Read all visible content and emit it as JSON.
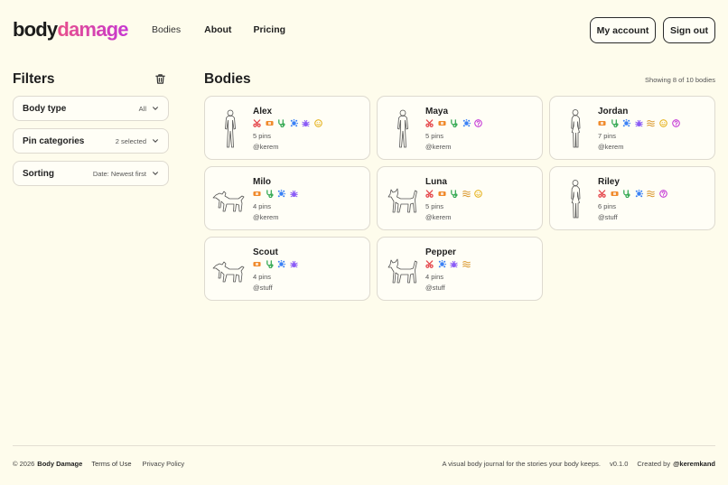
{
  "brand": {
    "part1": "body",
    "part2": "damage"
  },
  "nav": {
    "bodies": "Bodies",
    "about": "About",
    "pricing": "Pricing"
  },
  "header": {
    "my_account": "My account",
    "sign_out": "Sign out"
  },
  "sidebar": {
    "title": "Filters",
    "clear_icon": "trash-icon",
    "filters": [
      {
        "label": "Body type",
        "value": "All"
      },
      {
        "label": "Pin categories",
        "value": "2 selected"
      },
      {
        "label": "Sorting",
        "value": "Date: Newest first"
      }
    ]
  },
  "main": {
    "title": "Bodies",
    "showing": "Showing 8 of 10 bodies",
    "cards": [
      {
        "name": "Alex",
        "figure": "human-front-outline",
        "pins": "5 pins",
        "owner": "@kerem",
        "icons": [
          "scissors-icon",
          "bandage-icon",
          "stethoscope-icon",
          "virus-icon",
          "bug-icon",
          "smiley-icon"
        ]
      },
      {
        "name": "Maya",
        "figure": "human-front-outline",
        "pins": "5 pins",
        "owner": "@kerem",
        "icons": [
          "scissors-icon",
          "bandage-icon",
          "stethoscope-icon",
          "virus-icon",
          "question-icon"
        ]
      },
      {
        "name": "Jordan",
        "figure": "human-side-outline",
        "pins": "7 pins",
        "owner": "@kerem",
        "icons": [
          "bandage-icon",
          "stethoscope-icon",
          "virus-icon",
          "bug-icon",
          "waves-icon",
          "smiley-icon",
          "question-icon"
        ]
      },
      {
        "name": "Milo",
        "figure": "dog-outline",
        "pins": "4 pins",
        "owner": "@kerem",
        "icons": [
          "bandage-icon",
          "stethoscope-icon",
          "virus-icon",
          "bug-icon"
        ]
      },
      {
        "name": "Luna",
        "figure": "cat-outline",
        "pins": "5 pins",
        "owner": "@kerem",
        "icons": [
          "scissors-icon",
          "bandage-icon",
          "stethoscope-icon",
          "waves-icon",
          "smiley-icon"
        ]
      },
      {
        "name": "Riley",
        "figure": "human-side-outline",
        "pins": "6 pins",
        "owner": "@stuff",
        "icons": [
          "scissors-icon",
          "bandage-icon",
          "stethoscope-icon",
          "virus-icon",
          "waves-icon",
          "question-icon"
        ]
      },
      {
        "name": "Scout",
        "figure": "dog-outline",
        "pins": "4 pins",
        "owner": "@stuff",
        "icons": [
          "bandage-icon",
          "stethoscope-icon",
          "virus-icon",
          "bug-icon"
        ]
      },
      {
        "name": "Pepper",
        "figure": "cat-outline",
        "pins": "4 pins",
        "owner": "@stuff",
        "icons": [
          "scissors-icon",
          "virus-icon",
          "bug-icon",
          "waves-icon"
        ]
      }
    ]
  },
  "footer": {
    "copyright": "© 2026",
    "brand": "Body Damage",
    "terms": "Terms of Use",
    "privacy": "Privacy Policy",
    "tagline": "A visual body journal for the stories your body keeps.",
    "version": "v0.1.0",
    "created_by": "Created by",
    "handle": "@keremkand"
  },
  "icon_colors": {
    "scissors-icon": "#e5484d",
    "bandage-icon": "#f08a2c",
    "stethoscope-icon": "#32a852",
    "virus-icon": "#3b82f6",
    "bug-icon": "#8b5cf6",
    "waves-icon": "#d9962a",
    "smiley-icon": "#e6b422",
    "question-icon": "#c53ad6"
  }
}
